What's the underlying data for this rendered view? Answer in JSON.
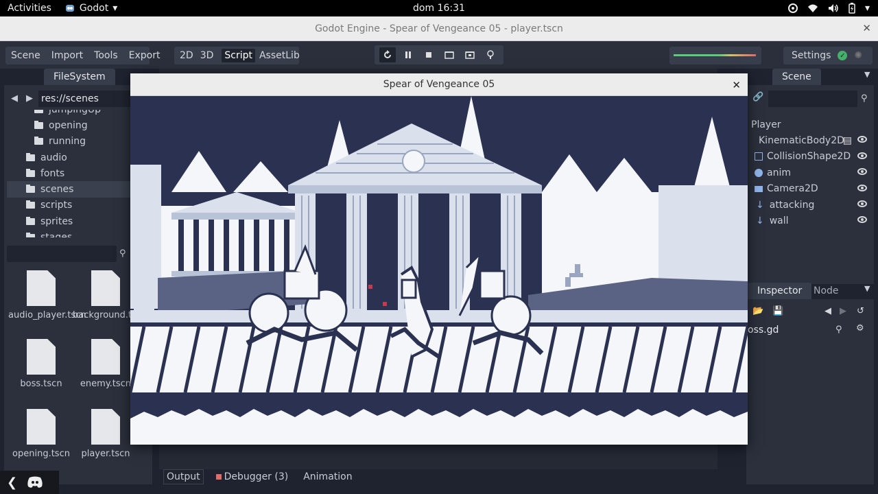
{
  "topbar": {
    "activities": "Activities",
    "app_name": "Godot",
    "clock": "dom 16:31"
  },
  "window": {
    "title": "Godot Engine - Spear of Vengeance 05 - player.tscn"
  },
  "menu": {
    "items": [
      "Scene",
      "Import",
      "Tools",
      "Export"
    ]
  },
  "workspaces": {
    "items": [
      "2D",
      "3D",
      "Script",
      "AssetLib"
    ],
    "active": "Script"
  },
  "settings": {
    "label": "Settings"
  },
  "filesystem": {
    "tab": "FileSystem",
    "path": "res://scenes",
    "tree": [
      {
        "label": "jumpingUp",
        "indent": 2
      },
      {
        "label": "opening",
        "indent": 2
      },
      {
        "label": "running",
        "indent": 2
      },
      {
        "label": "audio",
        "indent": 1
      },
      {
        "label": "fonts",
        "indent": 1
      },
      {
        "label": "scenes",
        "indent": 1,
        "selected": true
      },
      {
        "label": "scripts",
        "indent": 1
      },
      {
        "label": "sprites",
        "indent": 1
      },
      {
        "label": "stages",
        "indent": 1
      }
    ],
    "files": [
      "audio_player.tscn",
      "background.tscn",
      "boss.tscn",
      "enemy.tscn",
      "opening.tscn",
      "player.tscn"
    ]
  },
  "scene_dock": {
    "tab": "Scene",
    "root": "Player",
    "nodes": [
      "KinematicBody2D",
      "CollisionShape2D",
      "anim",
      "Camera2D",
      "attacking",
      "wall"
    ]
  },
  "inspector": {
    "tabs": [
      "Inspector",
      "Node"
    ],
    "resource": "oss.gd"
  },
  "bottom": {
    "tabs": [
      "Output",
      "Debugger (3)",
      "Animation"
    ]
  },
  "game": {
    "title": "Spear of Vengeance 05"
  },
  "colors": {
    "editor_bg": "#1f2330",
    "panel": "#2b303c",
    "game_dark": "#2b3150",
    "game_light": "#b9c3d8",
    "accent_red": "#e06b6b"
  }
}
